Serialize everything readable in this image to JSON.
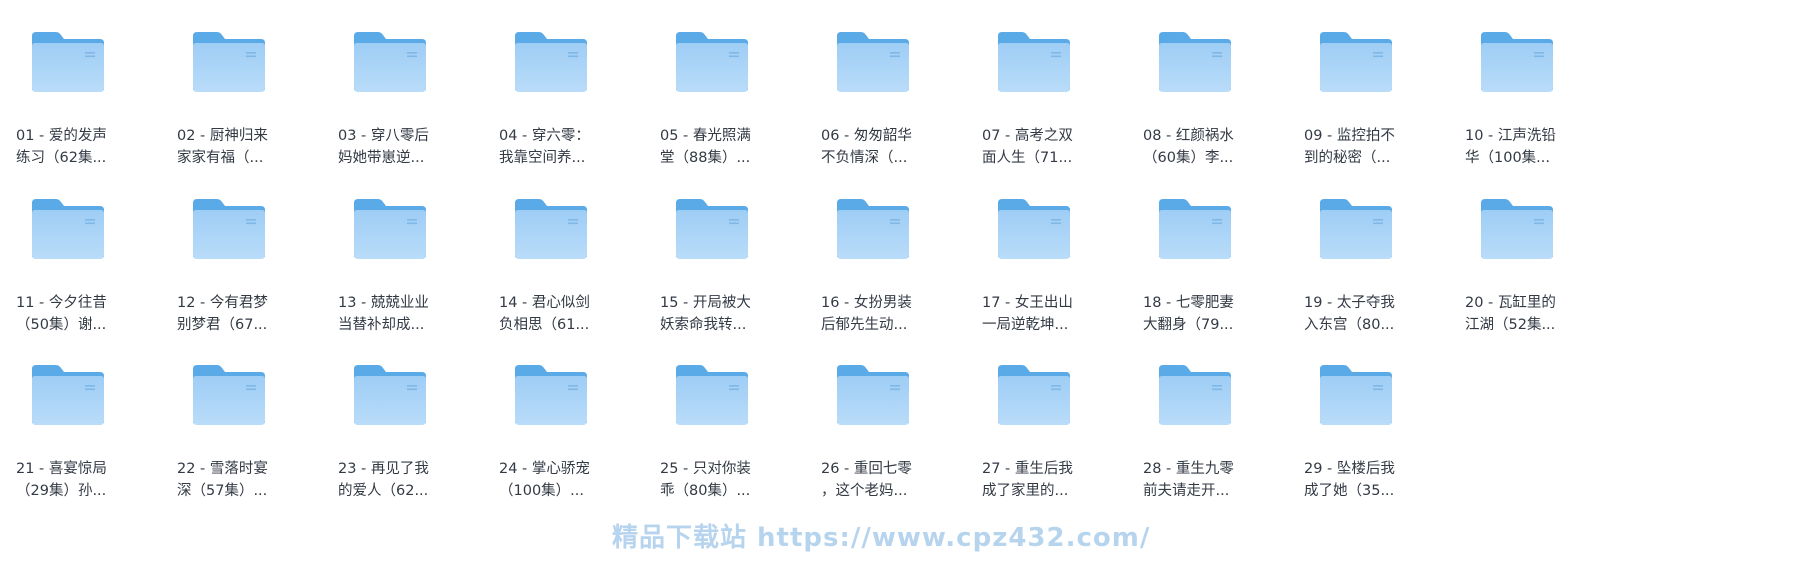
{
  "folders": [
    {
      "line1": "01 - 爱的发声",
      "line2": "练习（62集..."
    },
    {
      "line1": "02 - 厨神归来",
      "line2": "家家有福（..."
    },
    {
      "line1": "03 - 穿八零后",
      "line2": "妈她带崽逆..."
    },
    {
      "line1": "04 - 穿六零：",
      "line2": "我靠空间养..."
    },
    {
      "line1": "05 - 春光照满",
      "line2": "堂（88集）..."
    },
    {
      "line1": "06 - 匆匆韶华",
      "line2": "不负情深（..."
    },
    {
      "line1": "07 - 高考之双",
      "line2": "面人生（71..."
    },
    {
      "line1": "08 - 红颜祸水",
      "line2": "（60集）李..."
    },
    {
      "line1": "09 - 监控拍不",
      "line2": "到的秘密（..."
    },
    {
      "line1": "10 - 江声洗铅",
      "line2": "华（100集..."
    },
    {
      "line1": "11 - 今夕往昔",
      "line2": "（50集）谢..."
    },
    {
      "line1": "12 - 今有君梦",
      "line2": "别梦君（67..."
    },
    {
      "line1": "13 - 兢兢业业",
      "line2": "当替补却成..."
    },
    {
      "line1": "14 - 君心似剑",
      "line2": "负相思（61..."
    },
    {
      "line1": "15 - 开局被大",
      "line2": "妖索命我转..."
    },
    {
      "line1": "16 - 女扮男装",
      "line2": "后郁先生动..."
    },
    {
      "line1": "17 - 女王出山",
      "line2": "一局逆乾坤..."
    },
    {
      "line1": "18 - 七零肥妻",
      "line2": "大翻身（79..."
    },
    {
      "line1": "19 - 太子夺我",
      "line2": "入东宫（80..."
    },
    {
      "line1": "20 - 瓦缸里的",
      "line2": "江湖（52集..."
    },
    {
      "line1": "21 - 喜宴惊局",
      "line2": "（29集）孙..."
    },
    {
      "line1": "22 - 雪落时宴",
      "line2": "深（57集）..."
    },
    {
      "line1": "23 - 再见了我",
      "line2": "的爱人（62..."
    },
    {
      "line1": "24 - 掌心骄宠",
      "line2": "（100集）..."
    },
    {
      "line1": "25 - 只对你装",
      "line2": "乖（80集）..."
    },
    {
      "line1": "26 - 重回七零",
      "line2": "，这个老妈..."
    },
    {
      "line1": "27 - 重生后我",
      "line2": "成了家里的..."
    },
    {
      "line1": "28 - 重生九零",
      "line2": "前夫请走开..."
    },
    {
      "line1": "29 - 坠楼后我",
      "line2": "成了她（35..."
    }
  ],
  "watermark": "精品下载站 https://www.cpz432.com/",
  "colors": {
    "folder_back": "#5aaae8",
    "folder_front_top": "#9ecdf5",
    "folder_front_bottom": "#b9dcf9",
    "label_text": "#333a44"
  }
}
